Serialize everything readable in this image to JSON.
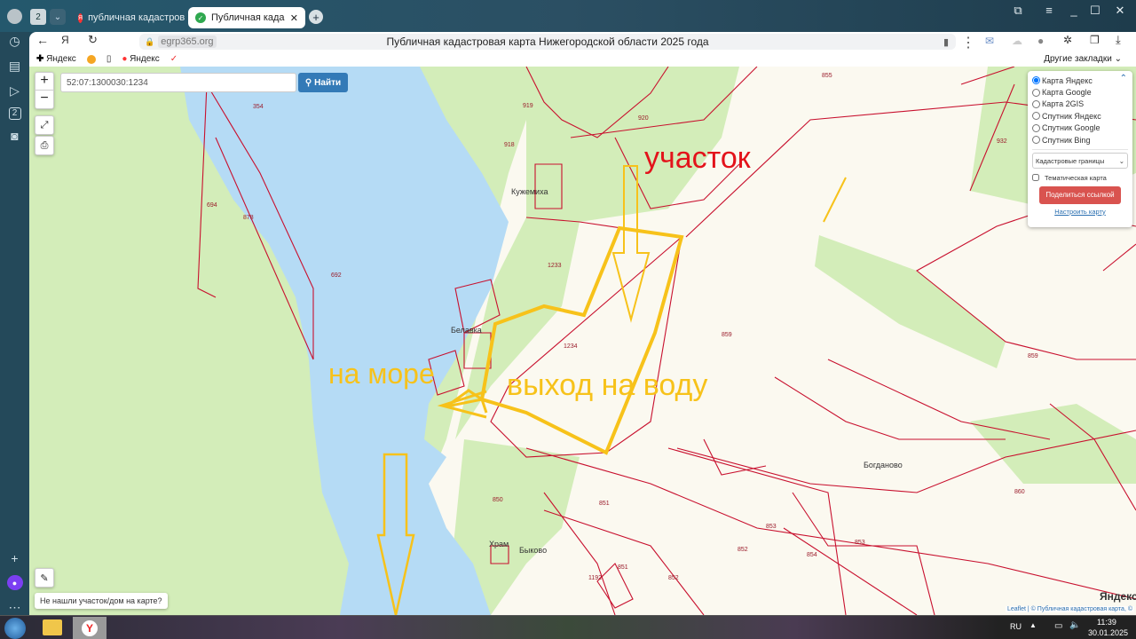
{
  "browser": {
    "tabs": [
      {
        "label": "публичная кадастровая к",
        "active": false
      },
      {
        "label": "Публичная кадастрова",
        "active": true
      }
    ],
    "tab_count_badge": "2",
    "url": "egrp365.org",
    "page_title": "Публичная кадастровая карта Нижегородской области 2025 года",
    "bookmarks": [
      "Яндекс",
      "Яндекс"
    ],
    "other_bookmarks": "Другие закладки",
    "sidebar_badge": "2"
  },
  "map": {
    "search_value": "52:07:1300030:1234",
    "search_button": "Найти",
    "zoom_in": "+",
    "zoom_out": "−",
    "not_found_label": "Не нашли участок/дом на карте?",
    "layers": {
      "options": [
        "Карта Яндекс",
        "Карта Google",
        "Карта 2GIS",
        "Спутник Яндекс",
        "Спутник Google",
        "Спутник Bing"
      ],
      "selected": "Карта Яндекс",
      "overlay_select": "Кадастровые границы",
      "thematic_label": "Тематическая карта",
      "thematic_checked": false,
      "share_button": "Поделиться ссылкой",
      "configure_link": "Настроить карту"
    },
    "parcel_labels": [
      "354",
      "919",
      "920",
      "855",
      "932",
      "918",
      "694",
      "878",
      "692",
      "1233",
      "1234",
      "859",
      "859",
      "860",
      "851",
      "853",
      "852",
      "851",
      "852",
      "1192",
      "853",
      "854",
      "850"
    ],
    "places": [
      "Кужемиха",
      "Белавка",
      "Богданово",
      "Храм",
      "Быково"
    ],
    "annotations": {
      "parcel": "участок",
      "sea": "на море",
      "water_access": "выход на воду"
    },
    "attribution_leaflet": "Leaflet",
    "attribution_text": "| © Публичная кадастровая карта, ©",
    "yandex_logo": "Яндекс",
    "colors": {
      "water": "#b5dbf5",
      "forest": "#d3edb9",
      "parcel_border": "#c8102e",
      "annotation_yellow": "#f7c21a",
      "annotation_red": "#e3131b",
      "accent_button": "#337ab7",
      "share_button": "#d9534f"
    }
  },
  "taskbar": {
    "language": "RU",
    "time": "11:39",
    "date": "30.01.2025"
  }
}
